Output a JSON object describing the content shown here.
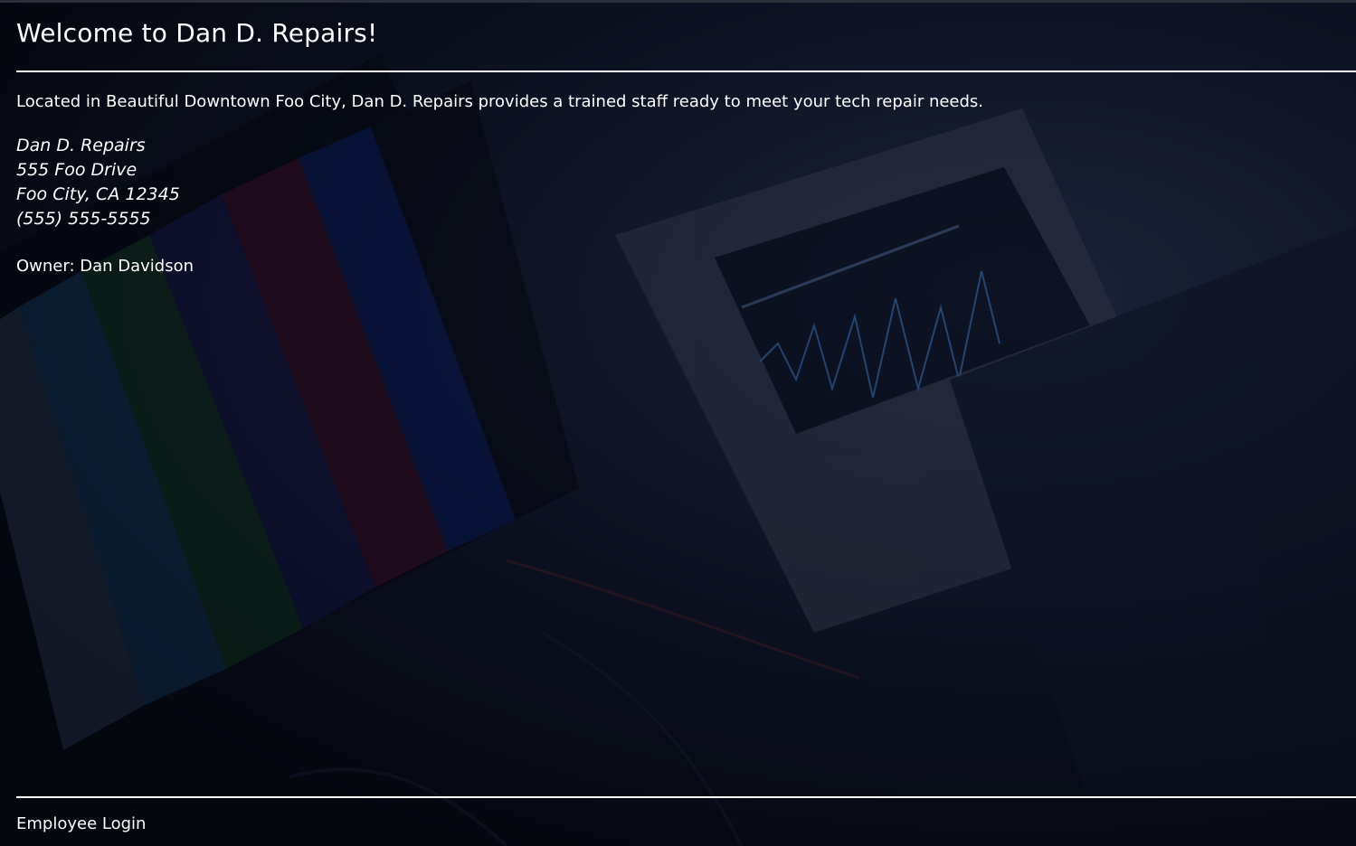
{
  "header": {
    "title": "Welcome to Dan D. Repairs!"
  },
  "main": {
    "intro": "Located in Beautiful Downtown Foo City, Dan D. Repairs provides a trained staff ready to meet your tech repair needs.",
    "address": {
      "name": "Dan D. Repairs",
      "street": "555 Foo Drive",
      "city_state_zip": "Foo City, CA 12345",
      "phone": "(555) 555-5555"
    },
    "owner": "Owner: Dan Davidson"
  },
  "footer": {
    "login_label": "Employee Login"
  },
  "colors": {
    "text": "#ffffff",
    "background": "#050814"
  }
}
